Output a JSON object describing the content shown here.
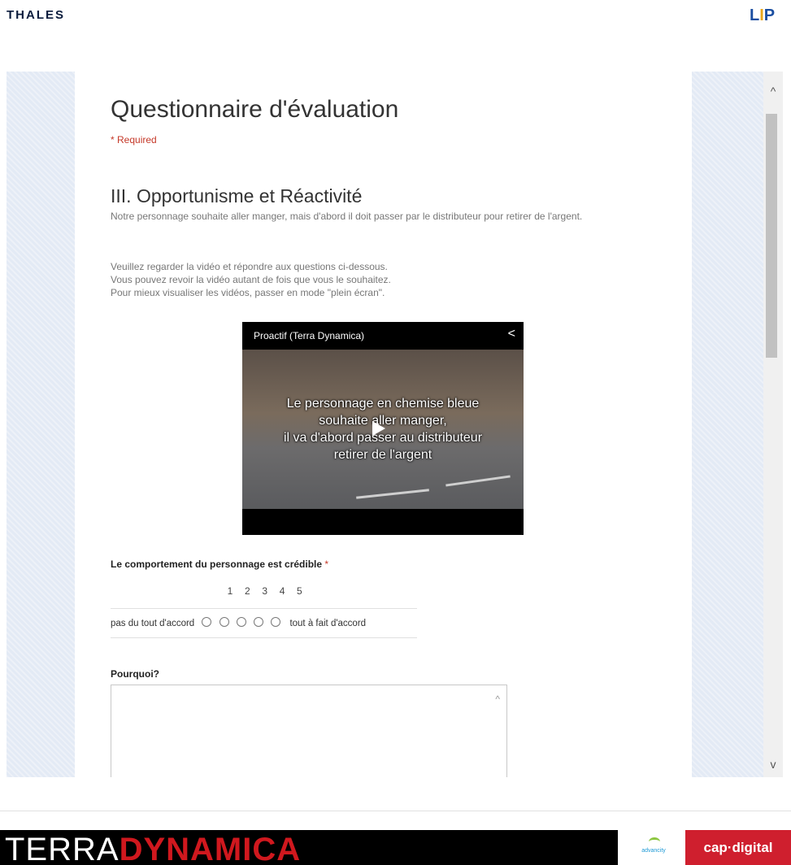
{
  "header": {
    "thales_logo": "THALES",
    "lip_logo": "LIP"
  },
  "form": {
    "title": "Questionnaire d'évaluation",
    "required_note": "* Required",
    "section_title": "III. Opportunisme et Réactivité",
    "section_description": "Notre personnage souhaite aller manger, mais d'abord il doit passer par le distributeur pour retirer de l'argent.",
    "instructions": [
      "Veuillez regarder la vidéo et répondre aux questions ci-dessous.",
      "Vous pouvez revoir la vidéo autant de fois que vous le souhaitez.",
      "Pour mieux visualiser les vidéos, passer en mode \"plein écran\"."
    ],
    "video": {
      "title": "Proactif (Terra Dynamica)",
      "subtitles": [
        "Le personnage en chemise bleue",
        "souhaite aller manger,",
        "il va d'abord passer au distributeur",
        "retirer de l'argent"
      ],
      "icons": [
        "share-icon",
        "play-icon"
      ]
    },
    "question1": {
      "label": "Le comportement du personnage est crédible",
      "required_mark": "*",
      "scale": [
        "1",
        "2",
        "3",
        "4",
        "5"
      ],
      "left_label": "pas du tout d'accord",
      "right_label": "tout à fait d'accord",
      "selected": null
    },
    "question2": {
      "label": "Pourquoi?",
      "value": ""
    }
  },
  "footer": {
    "terra_part1": "TERRA",
    "terra_part2": "DYNAMICA",
    "advancity": "advancity",
    "capdigital": "cap·digital"
  },
  "colors": {
    "required": "#c53929",
    "terra_red": "#d0181e",
    "capdigital_red": "#cf1f2e",
    "frame_bg": "#e3eaf5"
  }
}
